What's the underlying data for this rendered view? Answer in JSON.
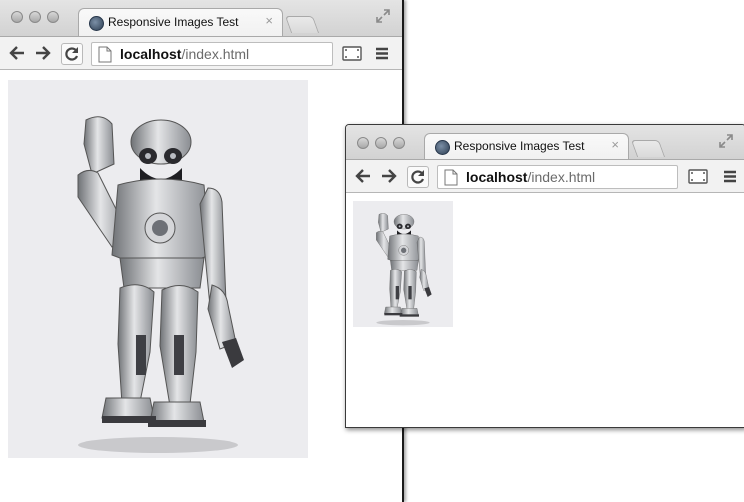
{
  "windows": [
    {
      "tab_title": "Responsive Images Test",
      "url_host": "localhost",
      "url_path": "/index.html",
      "image": "robot-photo"
    },
    {
      "tab_title": "Responsive Images Test",
      "url_host": "localhost",
      "url_path": "/index.html",
      "image": "robot-photo"
    }
  ],
  "icons": {
    "close": "×",
    "back": "arrow-left-icon",
    "forward": "arrow-right-icon",
    "reload": "reload-icon",
    "page": "page-icon",
    "cast": "cast-icon",
    "menu": "hamburger-icon",
    "expand": "fullscreen-icon"
  },
  "colors": {
    "chrome_frame": "#d6d6d6",
    "toolbar": "#f2f2f2",
    "image_background": "#ececef"
  }
}
